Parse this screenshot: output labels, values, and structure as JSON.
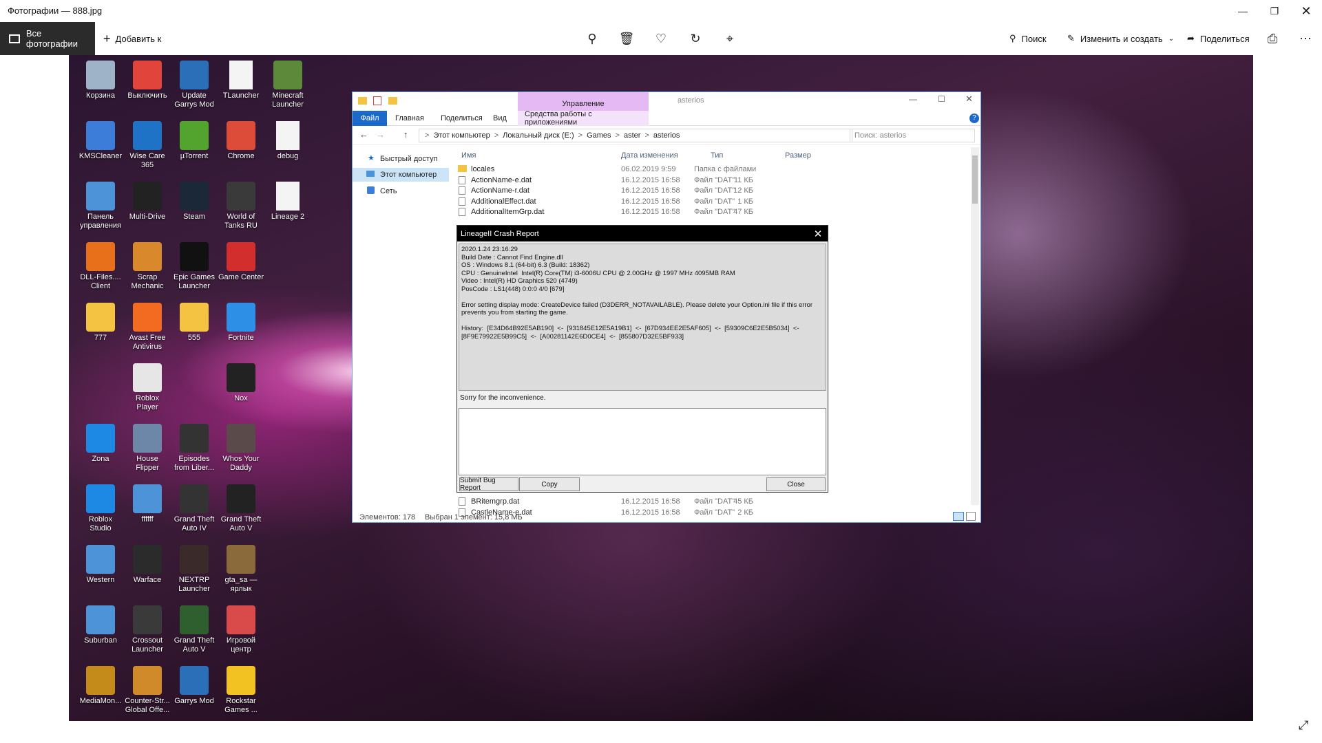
{
  "app": {
    "title": "Фотографии — 888.jpg"
  },
  "toolbar": {
    "all_photos": "Все фотографии",
    "add_to": "Добавить к",
    "search": "Поиск",
    "edit_create": "Изменить и создать",
    "share": "Поделиться"
  },
  "desktop_icons": [
    {
      "label": "Корзина",
      "icon": "recycle-bin-icon",
      "color": "#9fb3c8"
    },
    {
      "label": "Выключить",
      "icon": "power-icon",
      "color": "#e0443a"
    },
    {
      "label": "Update Garrys Mod",
      "icon": "garrys-mod-icon",
      "color": "#2a6fb8"
    },
    {
      "label": "TLauncher",
      "icon": "file-icon",
      "color": "#f4f4f4"
    },
    {
      "label": "Minecraft Launcher",
      "icon": "minecraft-icon",
      "color": "#5c8a3a"
    },
    {
      "label": "KMSCleaner",
      "icon": "kms-icon",
      "color": "#3b7dd8"
    },
    {
      "label": "Wise Care 365",
      "icon": "wise-care-icon",
      "color": "#1f73c7"
    },
    {
      "label": "µTorrent",
      "icon": "utorrent-icon",
      "color": "#53a32f"
    },
    {
      "label": "Chrome",
      "icon": "chrome-icon",
      "color": "#dd4b39"
    },
    {
      "label": "debug",
      "icon": "file-icon",
      "color": "#f4f4f4"
    },
    {
      "label": "Панель управления",
      "icon": "control-panel-icon",
      "color": "#4c93d8"
    },
    {
      "label": "Multi-Drive",
      "icon": "nox-icon",
      "color": "#222222"
    },
    {
      "label": "Steam",
      "icon": "steam-icon",
      "color": "#1b2838"
    },
    {
      "label": "World of Tanks RU",
      "icon": "wot-icon",
      "color": "#3a3a3a"
    },
    {
      "label": "Lineage 2",
      "icon": "file-icon",
      "color": "#f4f4f4"
    },
    {
      "label": "DLL-Files.... Client",
      "icon": "dll-files-icon",
      "color": "#e8701a"
    },
    {
      "label": "Scrap Mechanic",
      "icon": "scrap-mechanic-icon",
      "color": "#d9882b"
    },
    {
      "label": "Epic Games Launcher",
      "icon": "epic-games-icon",
      "color": "#111111"
    },
    {
      "label": "Game Center",
      "icon": "game-center-icon",
      "color": "#d22e2e"
    },
    {
      "label": "777",
      "icon": "folder-icon",
      "color": "#f5c342"
    },
    {
      "label": "Avast Free Antivirus",
      "icon": "avast-icon",
      "color": "#f26b21"
    },
    {
      "label": "555",
      "icon": "folder-icon",
      "color": "#f5c342"
    },
    {
      "label": "Fortnite",
      "icon": "fortnite-icon",
      "color": "#2e8fe6"
    },
    {
      "label": "Roblox Player",
      "icon": "roblox-icon",
      "color": "#e6e6e6"
    },
    {
      "label": "Nox",
      "icon": "nox-icon",
      "color": "#222222"
    },
    {
      "label": "Zona",
      "icon": "zona-icon",
      "color": "#1e88e5"
    },
    {
      "label": "House Flipper",
      "icon": "house-flipper-icon",
      "color": "#6d87a8"
    },
    {
      "label": "Episodes from Liber...",
      "icon": "gta-icon",
      "color": "#333333"
    },
    {
      "label": "Whos Your Daddy",
      "icon": "whos-your-daddy-icon",
      "color": "#5a4a4a"
    },
    {
      "label": "Roblox Studio",
      "icon": "roblox-studio-icon",
      "color": "#1e88e5"
    },
    {
      "label": "ffffff",
      "icon": "window-icon",
      "color": "#4c93d8"
    },
    {
      "label": "Grand Theft Auto IV",
      "icon": "gta-icon",
      "color": "#333333"
    },
    {
      "label": "Grand Theft Auto V",
      "icon": "gta-icon",
      "color": "#222222"
    },
    {
      "label": "Western",
      "icon": "window-icon",
      "color": "#4c93d8"
    },
    {
      "label": "Warface",
      "icon": "warface-icon",
      "color": "#2b2b2b"
    },
    {
      "label": "NEXTRP Launcher",
      "icon": "nextrp-icon",
      "color": "#3a2a2a"
    },
    {
      "label": "gta_sa — ярлык",
      "icon": "gta-sa-icon",
      "color": "#8a6a3a"
    },
    {
      "label": "Suburban",
      "icon": "window-icon",
      "color": "#4c93d8"
    },
    {
      "label": "Crossout Launcher",
      "icon": "crossout-icon",
      "color": "#3a3a3a"
    },
    {
      "label": "Grand Theft Auto V",
      "icon": "gta-v-icon",
      "color": "#2f5e2f"
    },
    {
      "label": "Игровой центр",
      "icon": "game-cube-icon",
      "color": "#d94a4a"
    },
    {
      "label": "MediaMon...",
      "icon": "mediamon-icon",
      "color": "#c48a1a"
    },
    {
      "label": "Counter-Str... Global Offe...",
      "icon": "csgo-icon",
      "color": "#d08a2a"
    },
    {
      "label": "Garrys Mod",
      "icon": "garrys-mod-icon",
      "color": "#2a6fb8"
    },
    {
      "label": "Rockstar Games ...",
      "icon": "rockstar-icon",
      "color": "#f2c122"
    }
  ],
  "explorer": {
    "context_tab": "Управление",
    "title": "asterios",
    "tabs": [
      "Файл",
      "Главная",
      "Поделиться",
      "Вид"
    ],
    "context_subtab": "Средства работы с приложениями",
    "path": [
      "Этот компьютер",
      "Локальный диск (E:)",
      "Games",
      "aster",
      "asterios"
    ],
    "search_placeholder": "Поиск: asterios",
    "nav": [
      "Быстрый доступ",
      "Этот компьютер",
      "Сеть"
    ],
    "columns": [
      "Имя",
      "Дата изменения",
      "Тип",
      "Размер"
    ],
    "files": [
      {
        "name": "locales",
        "date": "06.02.2019 9:59",
        "type": "Папка с файлами",
        "size": "",
        "folder": true
      },
      {
        "name": "ActionName-e.dat",
        "date": "16.12.2015 16:58",
        "type": "Файл \"DAT\"",
        "size": "11 КБ"
      },
      {
        "name": "ActionName-r.dat",
        "date": "16.12.2015 16:58",
        "type": "Файл \"DAT\"",
        "size": "12 КБ"
      },
      {
        "name": "AdditionalEffect.dat",
        "date": "16.12.2015 16:58",
        "type": "Файл \"DAT\"",
        "size": "1 КБ"
      },
      {
        "name": "AdditionalItemGrp.dat",
        "date": "16.12.2015 16:58",
        "type": "Файл \"DAT\"",
        "size": "47 КБ"
      }
    ],
    "files_after": [
      {
        "name": "BRitemgrp.dat",
        "date": "16.12.2015 16:58",
        "type": "Файл \"DAT\"",
        "size": "45 КБ"
      },
      {
        "name": "CastleName-e.dat",
        "date": "16.12.2015 16:58",
        "type": "Файл \"DAT\"",
        "size": "2 КБ"
      }
    ],
    "status_count": "Элементов: 178",
    "status_selected": "Выбран 1 элемент: 15,8 МБ"
  },
  "crash": {
    "title": "LineageII Crash Report",
    "report": "2020.1.24 23:16:29\nBuild Date : Cannot Find Engine.dll\nOS : Windows 8.1 (64-bit) 6.3 (Build: 18362)\nCPU : GenuineIntel  Intel(R) Core(TM) i3-6006U CPU @ 2.00GHz @ 1997 MHz 4095MB RAM\nVideo : Intel(R) HD Graphics 520 (4749)\nPosCode : LS1(448) 0:0:0 4/0 [679]\n\nError setting display mode: CreateDevice failed (D3DERR_NOTAVAILABLE). Please delete your Option.ini file if this error\nprevents you from starting the game.\n\nHistory:  [E34D64B92E5AB190]  <-  [931845E12E5A19B1]  <-  [67D934EE2E5AF605]  <-  [59309C6E2E5B5034]  <-\n[8F9E79922E5B99C5]  <-  [A00281142E6D0CE4]  <-  [855807D32E5BF933]",
    "sorry": "Sorry for the inconvenience.",
    "submit": "Submit Bug Report",
    "copy": "Copy",
    "close": "Close"
  }
}
